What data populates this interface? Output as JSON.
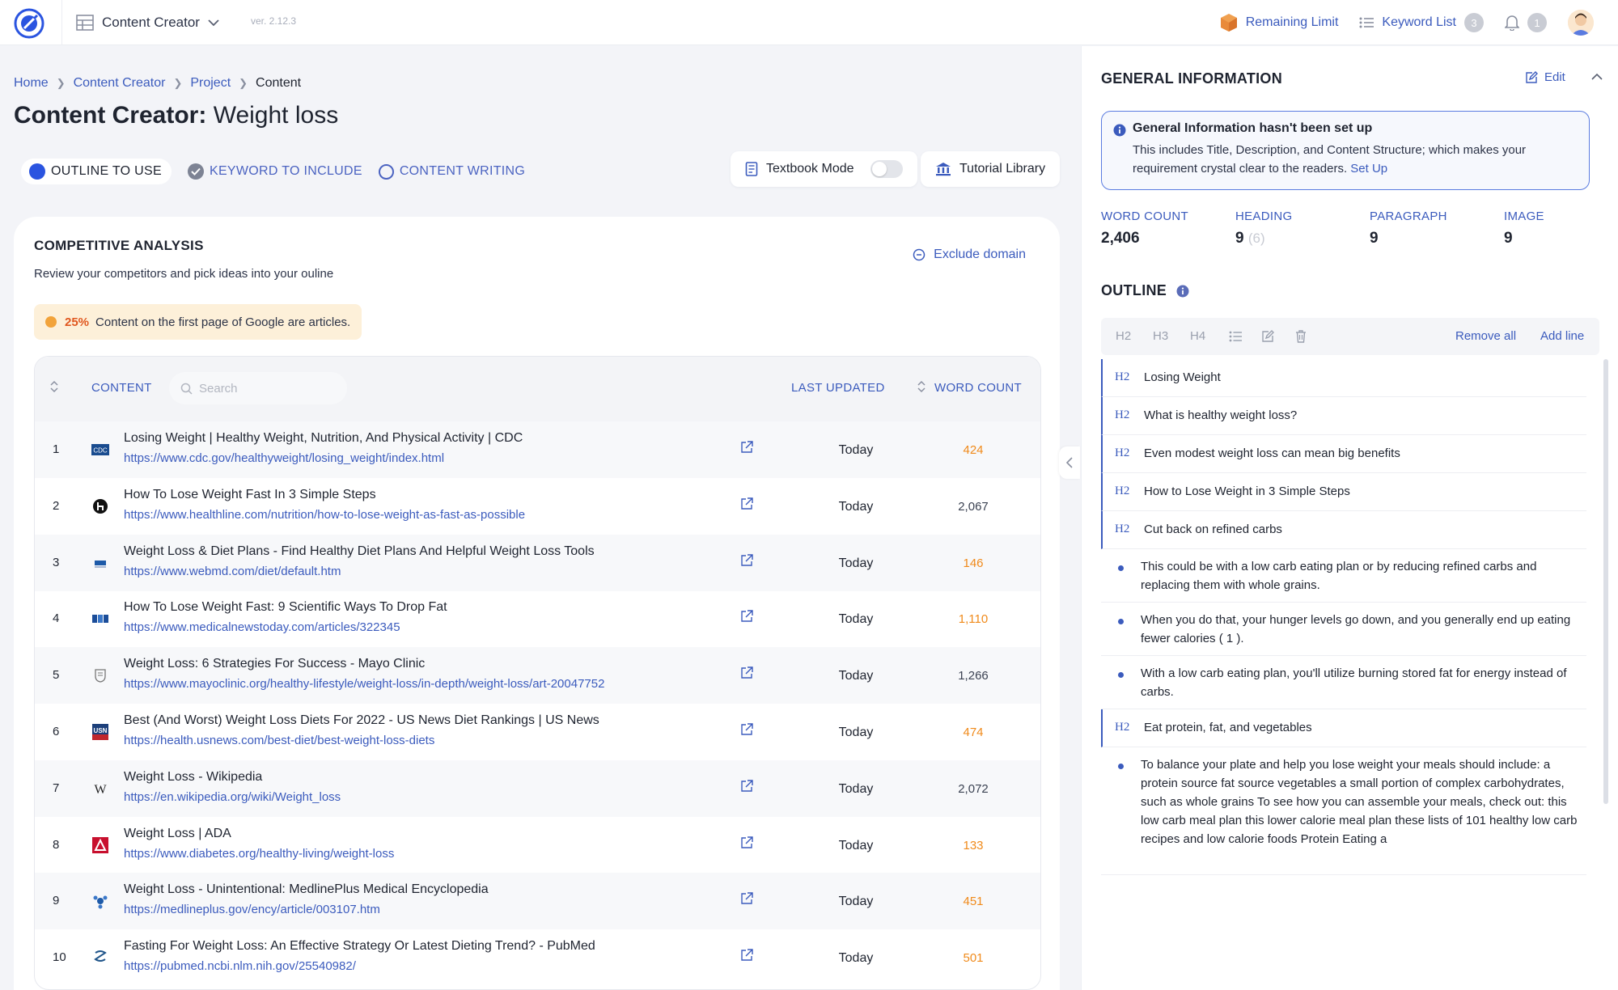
{
  "topbar": {
    "app_name": "Content Creator",
    "version": "ver. 2.12.3",
    "remaining_limit": "Remaining Limit",
    "keyword_list": "Keyword List",
    "keyword_count": "3",
    "notification_count": "1"
  },
  "breadcrumb": [
    "Home",
    "Content Creator",
    "Project",
    "Content"
  ],
  "page_title": {
    "prefix": "Content Creator:",
    "name": "Weight loss"
  },
  "steps": [
    "OUTLINE TO USE",
    "KEYWORD TO INCLUDE",
    "CONTENT WRITING"
  ],
  "toolbar": {
    "textbook_mode": "Textbook Mode",
    "tutorial_library": "Tutorial Library"
  },
  "competitive": {
    "title": "COMPETITIVE ANALYSIS",
    "subtitle": "Review your competitors and pick ideas into your ouline",
    "exclude_domain": "Exclude domain",
    "notice_pct": "25%",
    "notice_text": "Content on the first page of Google are articles.",
    "columns": {
      "content": "CONTENT",
      "last_updated": "LAST UPDATED",
      "word_count": "WORD COUNT"
    },
    "search_placeholder": "Search",
    "rows": [
      {
        "idx": "1",
        "title": "Losing Weight | Healthy Weight, Nutrition, And Physical Activity | CDC",
        "url": "https://www.cdc.gov/healthyweight/losing_weight/index.html",
        "updated": "Today",
        "words": "424",
        "warn": true,
        "favicon": "cdc-favicon"
      },
      {
        "idx": "2",
        "title": "How To Lose Weight Fast In 3 Simple Steps",
        "url": "https://www.healthline.com/nutrition/how-to-lose-weight-as-fast-as-possible",
        "updated": "Today",
        "words": "2,067",
        "warn": false,
        "favicon": "healthline-favicon"
      },
      {
        "idx": "3",
        "title": "Weight Loss & Diet Plans - Find Healthy Diet Plans And Helpful Weight Loss Tools",
        "url": "https://www.webmd.com/diet/default.htm",
        "updated": "Today",
        "words": "146",
        "warn": true,
        "favicon": "webmd-favicon"
      },
      {
        "idx": "4",
        "title": "How To Lose Weight Fast: 9 Scientific Ways To Drop Fat",
        "url": "https://www.medicalnewstoday.com/articles/322345",
        "updated": "Today",
        "words": "1,110",
        "warn": true,
        "favicon": "mnt-favicon"
      },
      {
        "idx": "5",
        "title": "Weight Loss: 6 Strategies For Success - Mayo Clinic",
        "url": "https://www.mayoclinic.org/healthy-lifestyle/weight-loss/in-depth/weight-loss/art-20047752",
        "updated": "Today",
        "words": "1,266",
        "warn": false,
        "favicon": "mayo-favicon"
      },
      {
        "idx": "6",
        "title": "Best (And Worst) Weight Loss Diets For 2022 - US News Diet Rankings | US News",
        "url": "https://health.usnews.com/best-diet/best-weight-loss-diets",
        "updated": "Today",
        "words": "474",
        "warn": true,
        "favicon": "usnews-favicon"
      },
      {
        "idx": "7",
        "title": "Weight Loss - Wikipedia",
        "url": "https://en.wikipedia.org/wiki/Weight_loss",
        "updated": "Today",
        "words": "2,072",
        "warn": false,
        "favicon": "wikipedia-favicon"
      },
      {
        "idx": "8",
        "title": "Weight Loss | ADA",
        "url": "https://www.diabetes.org/healthy-living/weight-loss",
        "updated": "Today",
        "words": "133",
        "warn": true,
        "favicon": "ada-favicon"
      },
      {
        "idx": "9",
        "title": "Weight Loss - Unintentional: MedlinePlus Medical Encyclopedia",
        "url": "https://medlineplus.gov/ency/article/003107.htm",
        "updated": "Today",
        "words": "451",
        "warn": true,
        "favicon": "medlineplus-favicon"
      },
      {
        "idx": "10",
        "title": "Fasting For Weight Loss: An Effective Strategy Or Latest Dieting Trend? - PubMed",
        "url": "https://pubmed.ncbi.nlm.nih.gov/25540982/",
        "updated": "Today",
        "words": "501",
        "warn": true,
        "favicon": "pubmed-favicon"
      }
    ]
  },
  "general": {
    "title": "GENERAL INFORMATION",
    "edit": "Edit",
    "info_title": "General Information hasn't been set up",
    "info_text": "This includes Title, Description, and Content Structure; which makes your requirement crystal clear to the readers.",
    "info_link": "Set Up",
    "stats": [
      {
        "label": "WORD COUNT",
        "value": "2,406",
        "extra": ""
      },
      {
        "label": "HEADING",
        "value": "9",
        "extra": "(6)"
      },
      {
        "label": "PARAGRAPH",
        "value": "9",
        "extra": ""
      },
      {
        "label": "IMAGE",
        "value": "9",
        "extra": ""
      }
    ]
  },
  "outline": {
    "title": "OUTLINE",
    "tools": [
      "H2",
      "H3",
      "H4"
    ],
    "remove_all": "Remove all",
    "add_line": "Add line",
    "items": [
      {
        "type": "h2",
        "tag": "H2",
        "text": "Losing Weight"
      },
      {
        "type": "h2",
        "tag": "H2",
        "text": "What is healthy weight loss?"
      },
      {
        "type": "h2",
        "tag": "H2",
        "text": "Even modest weight loss can mean big benefits"
      },
      {
        "type": "h2",
        "tag": "H2",
        "text": "How to Lose Weight in 3 Simple Steps"
      },
      {
        "type": "h2",
        "tag": "H2",
        "text": "Cut back on refined carbs"
      },
      {
        "type": "p",
        "text": "This could be with a low carb eating plan or by reducing refined carbs and replacing them with whole grains."
      },
      {
        "type": "p",
        "text": "When you do that, your hunger levels go down, and you generally end up eating fewer calories ( 1 )."
      },
      {
        "type": "p",
        "text": "With a low carb eating plan, you'll utilize burning stored fat for energy instead of carbs."
      },
      {
        "type": "h2",
        "tag": "H2",
        "text": "Eat protein, fat, and vegetables"
      },
      {
        "type": "p",
        "text": "To balance your plate and help you lose weight your meals should include: a protein source fat source vegetables a small portion of complex carbohydrates, such as whole grains To see how you can assemble your meals, check out: this low carb meal plan this lower calorie meal plan these lists of 101 healthy low carb recipes and low calorie foods Protein Eating a"
      }
    ]
  }
}
